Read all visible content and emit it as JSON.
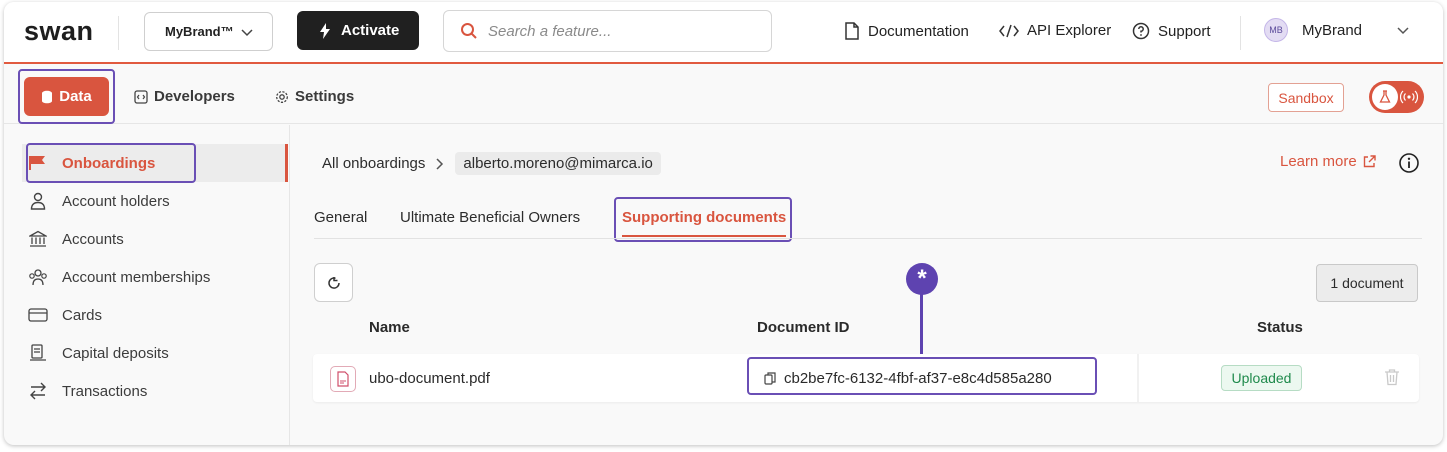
{
  "header": {
    "logo": "swan",
    "brand_select": "MyBrand™",
    "activate_label": "Activate",
    "search_placeholder": "Search a feature...",
    "links": [
      "Documentation",
      "API Explorer",
      "Support"
    ],
    "user": {
      "initials": "MB",
      "name": "MyBrand"
    }
  },
  "subnav": {
    "items": [
      "Data",
      "Developers",
      "Settings"
    ],
    "active": "Data",
    "sandbox_label": "Sandbox"
  },
  "sidebar": {
    "items": [
      "Onboardings",
      "Account holders",
      "Accounts",
      "Account memberships",
      "Cards",
      "Capital deposits",
      "Transactions"
    ],
    "active": "Onboardings"
  },
  "breadcrumb": {
    "root": "All onboardings",
    "current": "alberto.moreno@mimarca.io"
  },
  "learn_more": "Learn more",
  "tabs": {
    "items": [
      "General",
      "Ultimate Beneficial Owners",
      "Supporting documents"
    ],
    "active": "Supporting documents"
  },
  "toolbar": {
    "count_label": "1 document"
  },
  "table": {
    "columns": [
      "Name",
      "Document ID",
      "Status"
    ],
    "rows": [
      {
        "name": "ubo-document.pdf",
        "document_id": "cb2be7fc-6132-4fbf-af37-e8c4d585a280",
        "status": "Uploaded"
      }
    ]
  },
  "annotation": {
    "marker": "*"
  },
  "colors": {
    "accent": "#d9553f",
    "highlight": "#6a4fb5",
    "success": "#1f8a4c"
  }
}
